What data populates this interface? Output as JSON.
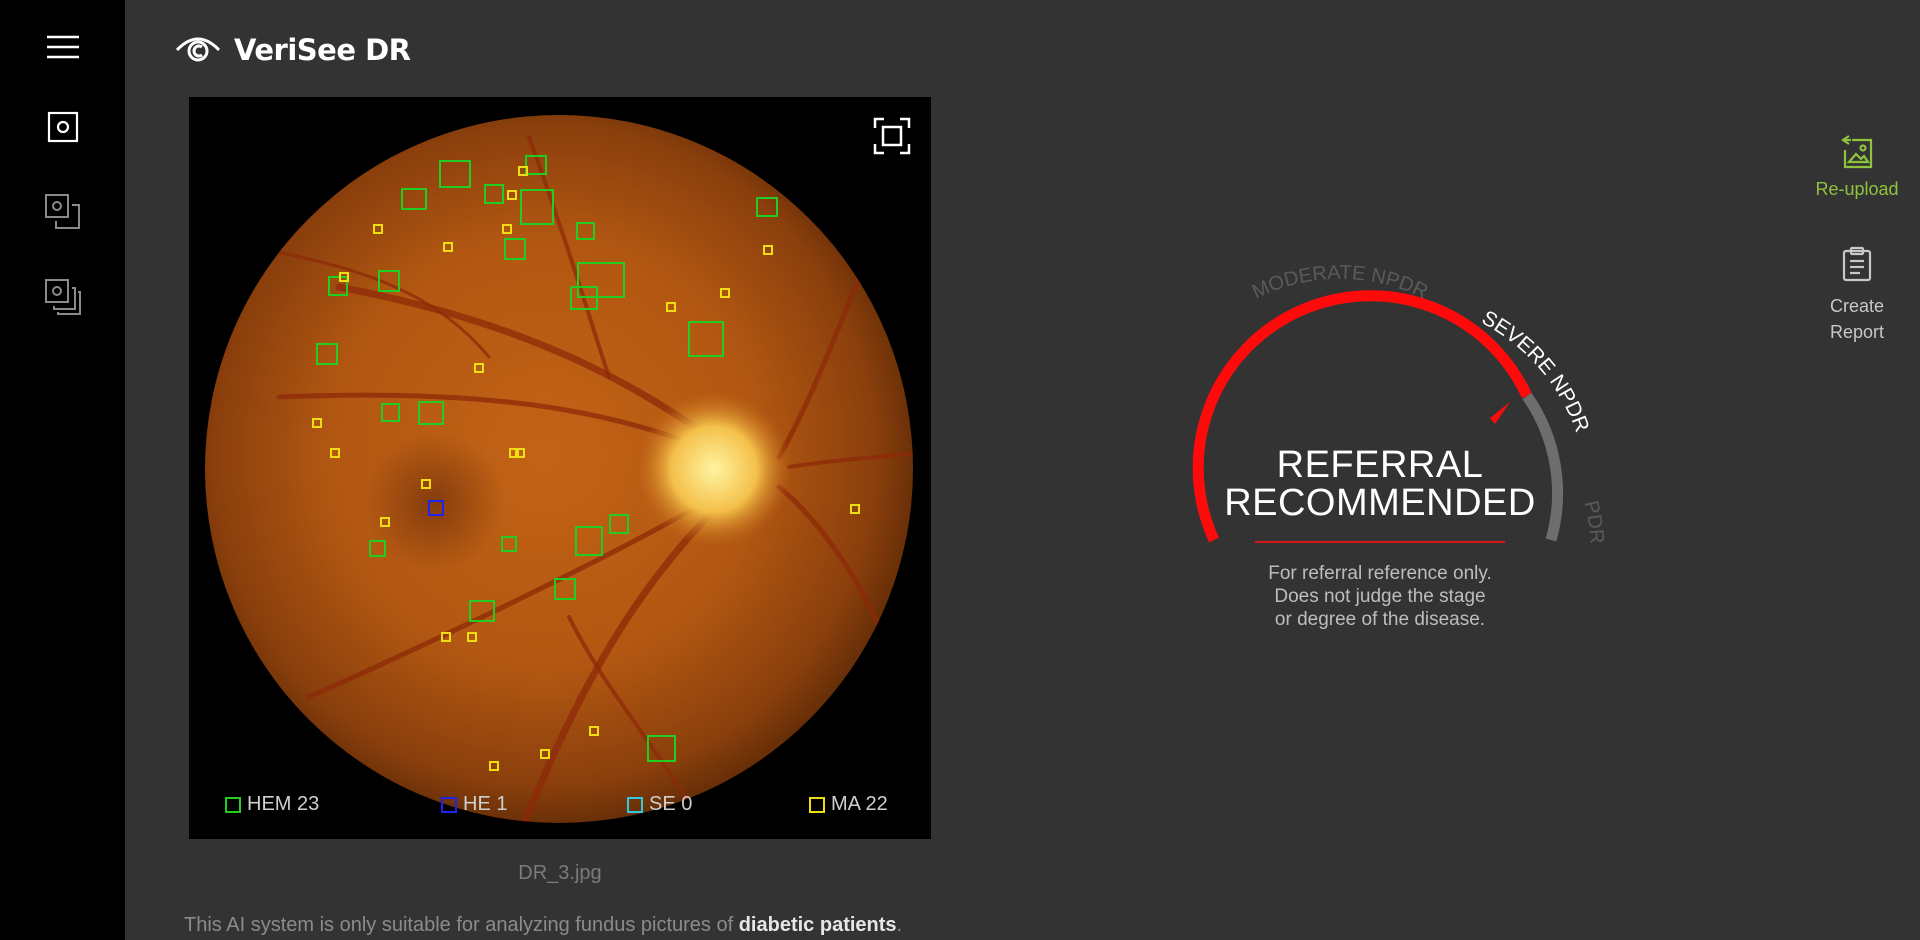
{
  "app": {
    "title": "VeriSee DR"
  },
  "sidebar": {
    "menu_icon": "hamburger-icon",
    "items": [
      {
        "name": "single-image",
        "icon": "single-image-icon",
        "active": true
      },
      {
        "name": "image-pair",
        "icon": "image-pair-icon",
        "active": false
      },
      {
        "name": "image-stack",
        "icon": "image-stack-icon",
        "active": false
      }
    ]
  },
  "image": {
    "filename": "DR_3.jpg",
    "expand_icon": "fullscreen-icon"
  },
  "legend": [
    {
      "label": "HEM 23",
      "color": "#22cc22"
    },
    {
      "label": "HE 1",
      "color": "#2222ee"
    },
    {
      "label": "SE 0",
      "color": "#33c8e0"
    },
    {
      "label": "MA 22",
      "color": "#eedd11"
    }
  ],
  "gauge": {
    "levels": [
      "MODERATE NPDR",
      "SEVERE NPDR",
      "PDR"
    ],
    "active_level": "SEVERE NPDR",
    "headline_line1": "REFERRAL",
    "headline_line2": "RECOMMENDED",
    "note_line1": "For referral reference only.",
    "note_line2": "Does not judge the stage",
    "note_line3": "or degree of the disease.",
    "accent_color": "#ee1111"
  },
  "actions": {
    "reupload": {
      "label": "Re-upload",
      "icon": "reupload-image-icon",
      "color": "#8fc33d"
    },
    "report": {
      "line1": "Create",
      "line2": "Report",
      "icon": "clipboard-icon"
    }
  },
  "footer": {
    "disclaimer_prefix": "This AI system is only suitable for analyzing fundus pictures of ",
    "disclaimer_emphasis": "diabetic patients",
    "disclaimer_suffix": "."
  }
}
